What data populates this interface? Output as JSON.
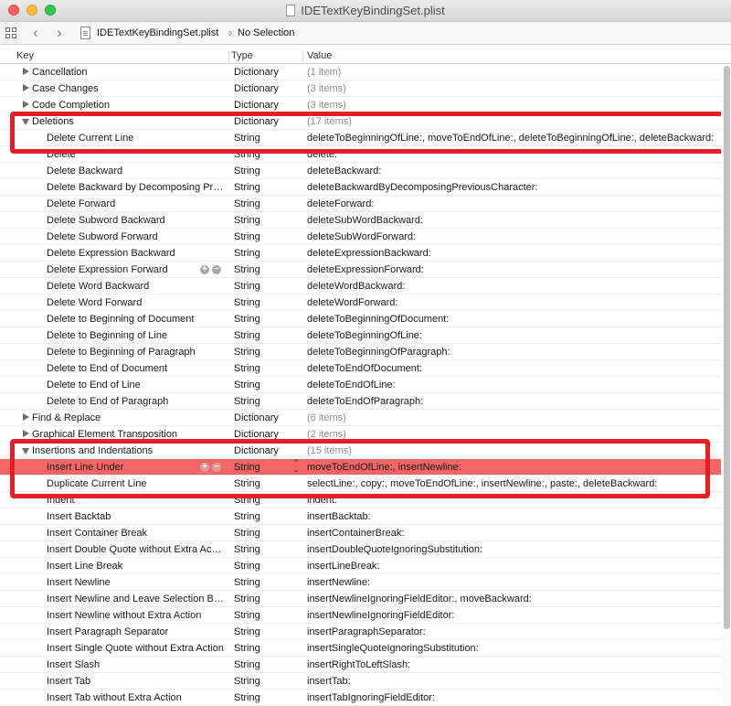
{
  "window": {
    "title": "IDETextKeyBindingSet.plist"
  },
  "navbar": {
    "file": "IDETextKeyBindingSet.plist",
    "selection": "No Selection"
  },
  "columns": {
    "key": "Key",
    "type": "Type",
    "value": "Value"
  },
  "highlight_color": "#e41e26",
  "selected_row_color": "#f46565",
  "icons": [
    "grid-icon",
    "chevron-left-icon",
    "chevron-right-icon",
    "file-icon",
    "disclosure-triangle-icon",
    "plus-icon",
    "minus-icon",
    "stepper-icon"
  ],
  "rows": [
    {
      "key": "Cancellation",
      "type": "Dictionary",
      "value": "(1 item)",
      "level": 0,
      "expanded": false
    },
    {
      "key": "Case Changes",
      "type": "Dictionary",
      "value": "(3 items)",
      "level": 0,
      "expanded": false
    },
    {
      "key": "Code Completion",
      "type": "Dictionary",
      "value": "(3 items)",
      "level": 0,
      "expanded": false
    },
    {
      "key": "Deletions",
      "type": "Dictionary",
      "value": "(17 items)",
      "level": 0,
      "expanded": true
    },
    {
      "key": "Delete Current Line",
      "type": "String",
      "value": "deleteToBeginningOfLine:, moveToEndOfLine:, deleteToBeginningOfLine:, deleteBackward:",
      "level": 1
    },
    {
      "key": "Delete",
      "type": "String",
      "value": "delete:",
      "level": 1
    },
    {
      "key": "Delete Backward",
      "type": "String",
      "value": "deleteBackward:",
      "level": 1
    },
    {
      "key": "Delete Backward by Decomposing Previous Character",
      "type": "String",
      "value": "deleteBackwardByDecomposingPreviousCharacter:",
      "level": 1
    },
    {
      "key": "Delete Forward",
      "type": "String",
      "value": "deleteForward:",
      "level": 1
    },
    {
      "key": "Delete Subword Backward",
      "type": "String",
      "value": "deleteSubWordBackward:",
      "level": 1
    },
    {
      "key": "Delete Subword Forward",
      "type": "String",
      "value": "deleteSubWordForward:",
      "level": 1
    },
    {
      "key": "Delete Expression Backward",
      "type": "String",
      "value": "deleteExpressionBackward:",
      "level": 1
    },
    {
      "key": "Delete Expression Forward",
      "type": "String",
      "value": "deleteExpressionForward:",
      "level": 1,
      "hover": true
    },
    {
      "key": "Delete Word Backward",
      "type": "String",
      "value": "deleteWordBackward:",
      "level": 1
    },
    {
      "key": "Delete Word Forward",
      "type": "String",
      "value": "deleteWordForward:",
      "level": 1
    },
    {
      "key": "Delete to Beginning of Document",
      "type": "String",
      "value": "deleteToBeginningOfDocument:",
      "level": 1
    },
    {
      "key": "Delete to Beginning of Line",
      "type": "String",
      "value": "deleteToBeginningOfLine:",
      "level": 1
    },
    {
      "key": "Delete to Beginning of Paragraph",
      "type": "String",
      "value": "deleteToBeginningOfParagraph:",
      "level": 1
    },
    {
      "key": "Delete to End of Document",
      "type": "String",
      "value": "deleteToEndOfDocument:",
      "level": 1
    },
    {
      "key": "Delete to End of Line",
      "type": "String",
      "value": "deleteToEndOfLine:",
      "level": 1
    },
    {
      "key": "Delete to End of Paragraph",
      "type": "String",
      "value": "deleteToEndOfParagraph:",
      "level": 1
    },
    {
      "key": "Find & Replace",
      "type": "Dictionary",
      "value": "(6 items)",
      "level": 0,
      "expanded": false
    },
    {
      "key": "Graphical Element Transposition",
      "type": "Dictionary",
      "value": "(2 items)",
      "level": 0,
      "expanded": false
    },
    {
      "key": "Insertions and Indentations",
      "type": "Dictionary",
      "value": "(15 items)",
      "level": 0,
      "expanded": true
    },
    {
      "key": "Insert Line Under",
      "type": "String",
      "value": "moveToEndOfLine:, insertNewline:",
      "level": 1,
      "selected": true
    },
    {
      "key": "Duplicate Current Line",
      "type": "String",
      "value": "selectLine:, copy:, moveToEndOfLine:, insertNewline:, paste:, deleteBackward:",
      "level": 1
    },
    {
      "key": "Indent",
      "type": "String",
      "value": "indent:",
      "level": 1
    },
    {
      "key": "Insert Backtab",
      "type": "String",
      "value": "insertBacktab:",
      "level": 1
    },
    {
      "key": "Insert Container Break",
      "type": "String",
      "value": "insertContainerBreak:",
      "level": 1
    },
    {
      "key": "Insert Double Quote without Extra Action",
      "type": "String",
      "value": "insertDoubleQuoteIgnoringSubstitution:",
      "level": 1
    },
    {
      "key": "Insert Line Break",
      "type": "String",
      "value": "insertLineBreak:",
      "level": 1
    },
    {
      "key": "Insert Newline",
      "type": "String",
      "value": "insertNewline:",
      "level": 1
    },
    {
      "key": "Insert Newline and Leave Selection Before It",
      "type": "String",
      "value": "insertNewlineIgnoringFieldEditor:, moveBackward:",
      "level": 1
    },
    {
      "key": "Insert Newline without Extra Action",
      "type": "String",
      "value": "insertNewlineIgnoringFieldEditor:",
      "level": 1
    },
    {
      "key": "Insert Paragraph Separator",
      "type": "String",
      "value": "insertParagraphSeparator:",
      "level": 1
    },
    {
      "key": "Insert Single Quote without Extra Action",
      "type": "String",
      "value": "insertSingleQuoteIgnoringSubstitution:",
      "level": 1
    },
    {
      "key": "Insert Slash",
      "type": "String",
      "value": "insertRightToLeftSlash:",
      "level": 1
    },
    {
      "key": "Insert Tab",
      "type": "String",
      "value": "insertTab:",
      "level": 1
    },
    {
      "key": "Insert Tab without Extra Action",
      "type": "String",
      "value": "insertTabIgnoringFieldEditor:",
      "level": 1
    }
  ]
}
